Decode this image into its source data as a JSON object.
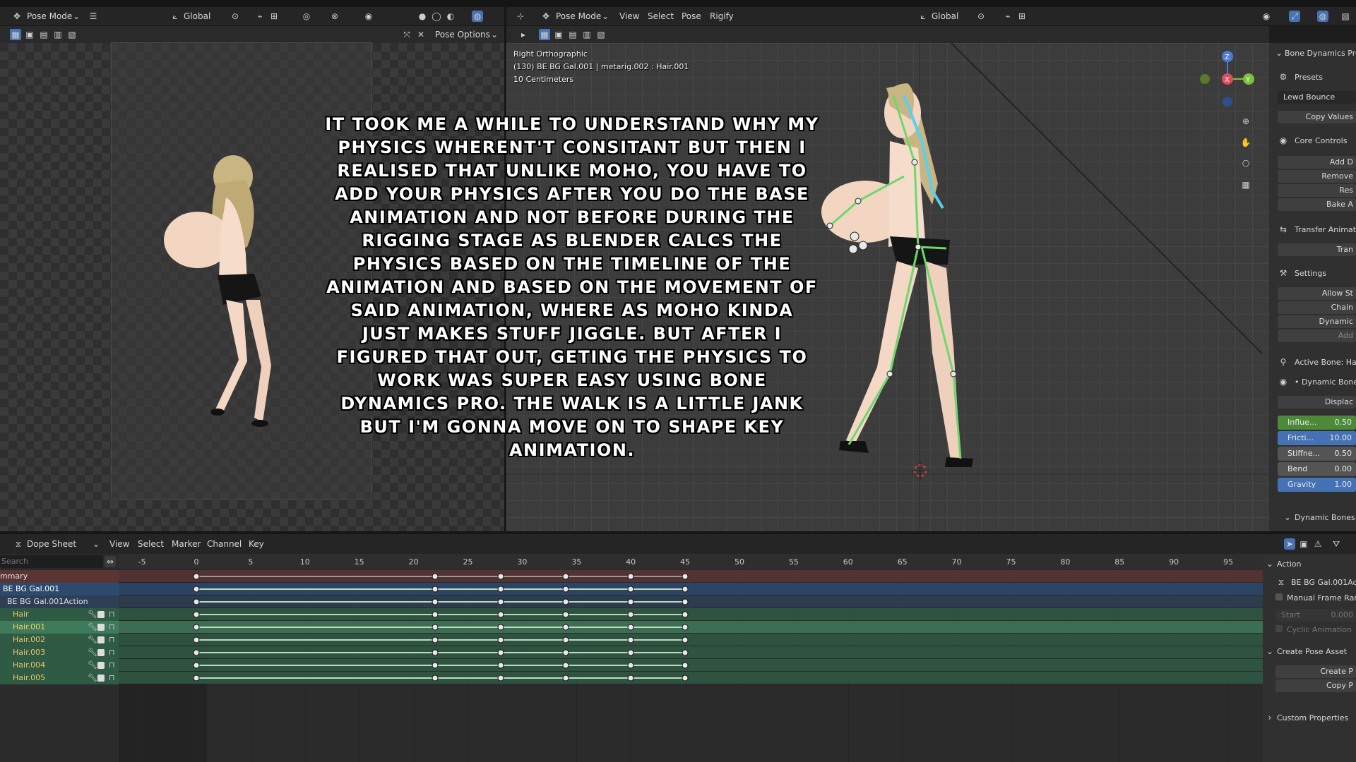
{
  "left_header": {
    "mode": "Pose Mode",
    "orientation": "Global",
    "pose_options": "Pose Options"
  },
  "right_header": {
    "mode": "Pose Mode",
    "menus": [
      "View",
      "Select",
      "Pose",
      "Rigify"
    ],
    "orientation": "Global"
  },
  "viewport": {
    "view_name": "Right Orthographic",
    "object_info": "(130) BE BG Gal.001 | metarig.002 : Hair.001",
    "scale": "10 Centimeters"
  },
  "caption": "It took me a while to understand why my physics wherent't consitant but then I realised that unlike moho, you have to add your physics after you do the base animation and not before during the rigging stage as Blender calcs the physics based on the timeline of the animation and based on the movement of said animation, where as moho kinda just makes stuff jiggle. But after I figured that out, geting the physics to work was super easy using Bone Dynamics Pro. The walk is a little jank but I'm gonna move on to shape key animation.",
  "npanel": {
    "title": "Bone Dynamics Pro",
    "presets_label": "Presets",
    "preset_value": "Lewd Bounce",
    "copy_values": "Copy Values",
    "core_controls": "Core Controls",
    "add": "Add D",
    "remove": "Remove",
    "reset": "Res",
    "bake": "Bake A",
    "transfer": "Transfer Animat",
    "tran": "Tran",
    "settings": "Settings",
    "allow": "Allow St",
    "chain": "Chain",
    "dynamic": "Dynamic",
    "add2": "Add",
    "active_bone": "Active Bone: Hai",
    "dynamic_bone": "• Dynamic Bone",
    "displace": "Displac",
    "sliders": [
      {
        "label": "Influe...",
        "value": "0.50",
        "fill": 1.0,
        "color": "#4c8a3a"
      },
      {
        "label": "Fricti...",
        "value": "10.00",
        "fill": 1.0,
        "color": "#4472b4"
      },
      {
        "label": "Stiffne...",
        "value": "0.50",
        "fill": 0.0,
        "color": "#4c8a3a"
      },
      {
        "label": "Bend",
        "value": "0.00",
        "fill": 0.0,
        "color": "#4c8a3a"
      },
      {
        "label": "Gravity",
        "value": "1.00",
        "fill": 1.0,
        "color": "#4472b4"
      }
    ],
    "dynamic_bones": "Dynamic Bones"
  },
  "dopesheet": {
    "editor": "Dope Sheet",
    "menus": [
      "View",
      "Select",
      "Marker",
      "Channel",
      "Key"
    ],
    "search_placeholder": "Search",
    "ticks": [
      "-5",
      "0",
      "5",
      "10",
      "15",
      "20",
      "25",
      "30",
      "35",
      "40",
      "45",
      "50",
      "55",
      "60",
      "65",
      "70",
      "75",
      "80",
      "85",
      "90",
      "95"
    ],
    "tick_values": [
      -5,
      0,
      5,
      10,
      15,
      20,
      25,
      30,
      35,
      40,
      45,
      50,
      55,
      60,
      65,
      70,
      75,
      80,
      85,
      90,
      95
    ],
    "keyframes": [
      0,
      22,
      28,
      34,
      40,
      45
    ],
    "channels": [
      {
        "name": "mmary",
        "kind": "summary"
      },
      {
        "name": "BE BG Gal.001",
        "kind": "object"
      },
      {
        "name": "BE BG Gal.001Action",
        "kind": "action"
      },
      {
        "name": "Hair",
        "kind": "bone"
      },
      {
        "name": "Hair.001",
        "kind": "bone-active"
      },
      {
        "name": "Hair.002",
        "kind": "bone"
      },
      {
        "name": "Hair.003",
        "kind": "bone"
      },
      {
        "name": "Hair.004",
        "kind": "bone"
      },
      {
        "name": "Hair.005",
        "kind": "bone"
      }
    ]
  },
  "action_panel": {
    "action": "Action",
    "action_name": "BE BG Gal.001Ac",
    "manual_frame": "Manual Frame Ran",
    "start_label": "Start",
    "start_value": "0.000",
    "cyclic": "Cyclic Animation",
    "create_pose_asset": "Create Pose Asset",
    "create_p": "Create P",
    "copy_p": "Copy P",
    "custom_properties": "Custom Properties"
  },
  "colors": {
    "summary_row": "#5a3534",
    "object_row": "#2d4a6e",
    "action_row": "#2e3f55",
    "bone_row": "#2f5a44",
    "accent_blue": "#4472b4",
    "bone_green": "#6bd96b"
  }
}
